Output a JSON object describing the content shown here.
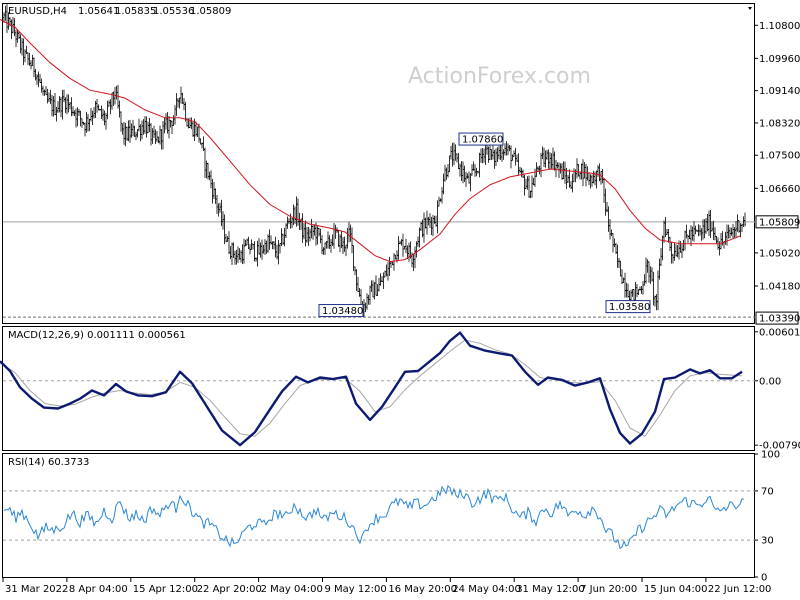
{
  "chart_data": {
    "type": "candlestick",
    "header": {
      "symbol": "EURUSD,H4",
      "open": "1.05641",
      "high": "1.05835",
      "low": "1.05536",
      "close": "1.05809"
    },
    "watermark": "ActionForex.com",
    "colors": {
      "background": "#ffffff",
      "bars": "#000000",
      "ma": "#d2141e",
      "macd": "#0d1a72",
      "signal": "#a7a7a7",
      "rsi": "#2a86d8",
      "watermark": "#cfcfcf",
      "grid": "#a0a0a0"
    },
    "x_labels": [
      "31 Mar 2022",
      "8 Apr 04:00",
      "15 Apr 12:00",
      "22 Apr 20:00",
      "2 May 04:00",
      "9 May 12:00",
      "16 May 20:00",
      "24 May 04:00",
      "31 May 12:00",
      "7 Jun 20:00",
      "15 Jun 04:00",
      "22 Jun 12:00"
    ],
    "price": {
      "ylim": [
        1.0324,
        1.1134
      ],
      "ticks": [
        "1.10800",
        "1.09960",
        "1.09140",
        "1.08320",
        "1.07500",
        "1.06660",
        "1.05020",
        "1.04180"
      ],
      "current": {
        "value": 1.05809,
        "label": "1.05809"
      },
      "low_line": {
        "value": 1.0339,
        "label": "1.03390"
      },
      "annotations": [
        {
          "label": "1.03480",
          "value": 1.0348,
          "index": 363
        },
        {
          "label": "1.07860",
          "value": 1.0786,
          "index": 503
        },
        {
          "label": "1.03580",
          "value": 1.0358,
          "index": 650
        }
      ],
      "close_path": [
        [
          4,
          1.11
        ],
        [
          15,
          1.106
        ],
        [
          25,
          1.1
        ],
        [
          35,
          1.097
        ],
        [
          45,
          1.089
        ],
        [
          55,
          1.087
        ],
        [
          65,
          1.089
        ],
        [
          75,
          1.086
        ],
        [
          85,
          1.083
        ],
        [
          95,
          1.087
        ],
        [
          105,
          1.084
        ],
        [
          115,
          1.091
        ],
        [
          123,
          1.08
        ],
        [
          135,
          1.081
        ],
        [
          145,
          1.083
        ],
        [
          155,
          1.078
        ],
        [
          165,
          1.082
        ],
        [
          175,
          1.085
        ],
        [
          180,
          1.092
        ],
        [
          188,
          1.083
        ],
        [
          198,
          1.081
        ],
        [
          205,
          1.073
        ],
        [
          212,
          1.067
        ],
        [
          220,
          1.06
        ],
        [
          228,
          1.052
        ],
        [
          238,
          1.049
        ],
        [
          248,
          1.052
        ],
        [
          258,
          1.05
        ],
        [
          268,
          1.053
        ],
        [
          278,
          1.05
        ],
        [
          288,
          1.058
        ],
        [
          296,
          1.061
        ],
        [
          305,
          1.054
        ],
        [
          315,
          1.056
        ],
        [
          325,
          1.051
        ],
        [
          335,
          1.055
        ],
        [
          343,
          1.052
        ],
        [
          350,
          1.055
        ],
        [
          356,
          1.044
        ],
        [
          362,
          1.036
        ],
        [
          370,
          1.04
        ],
        [
          380,
          1.042
        ],
        [
          388,
          1.046
        ],
        [
          396,
          1.051
        ],
        [
          404,
          1.053
        ],
        [
          412,
          1.049
        ],
        [
          420,
          1.056
        ],
        [
          428,
          1.058
        ],
        [
          436,
          1.059
        ],
        [
          444,
          1.07
        ],
        [
          452,
          1.075
        ],
        [
          460,
          1.072
        ],
        [
          468,
          1.068
        ],
        [
          476,
          1.071
        ],
        [
          485,
          1.077
        ],
        [
          493,
          1.074
        ],
        [
          503,
          1.077
        ],
        [
          512,
          1.075
        ],
        [
          520,
          1.07
        ],
        [
          530,
          1.066
        ],
        [
          540,
          1.073
        ],
        [
          550,
          1.075
        ],
        [
          560,
          1.071
        ],
        [
          570,
          1.068
        ],
        [
          580,
          1.072
        ],
        [
          590,
          1.069
        ],
        [
          600,
          1.071
        ],
        [
          608,
          1.058
        ],
        [
          616,
          1.049
        ],
        [
          624,
          1.043
        ],
        [
          632,
          1.039
        ],
        [
          640,
          1.041
        ],
        [
          648,
          1.047
        ],
        [
          656,
          1.037
        ],
        [
          664,
          1.058
        ],
        [
          672,
          1.05
        ],
        [
          680,
          1.052
        ],
        [
          690,
          1.055
        ],
        [
          700,
          1.055
        ],
        [
          710,
          1.058
        ],
        [
          720,
          1.052
        ],
        [
          730,
          1.055
        ],
        [
          740,
          1.058
        ]
      ],
      "ma_path": [
        [
          0,
          1.1095
        ],
        [
          15,
          1.1075
        ],
        [
          30,
          1.1035
        ],
        [
          50,
          1.0985
        ],
        [
          70,
          1.0945
        ],
        [
          90,
          1.0915
        ],
        [
          110,
          1.0905
        ],
        [
          125,
          1.0895
        ],
        [
          145,
          1.0865
        ],
        [
          165,
          1.0845
        ],
        [
          180,
          1.0845
        ],
        [
          195,
          1.0835
        ],
        [
          210,
          1.0795
        ],
        [
          230,
          1.0735
        ],
        [
          250,
          1.0675
        ],
        [
          270,
          1.0625
        ],
        [
          290,
          1.0595
        ],
        [
          310,
          1.0575
        ],
        [
          330,
          1.0565
        ],
        [
          345,
          1.0555
        ],
        [
          360,
          1.0525
        ],
        [
          375,
          1.0495
        ],
        [
          390,
          1.048
        ],
        [
          405,
          1.0485
        ],
        [
          420,
          1.051
        ],
        [
          440,
          1.055
        ],
        [
          455,
          1.06
        ],
        [
          470,
          1.064
        ],
        [
          490,
          1.0675
        ],
        [
          510,
          1.0695
        ],
        [
          530,
          1.0705
        ],
        [
          550,
          1.0715
        ],
        [
          570,
          1.071
        ],
        [
          590,
          1.0705
        ],
        [
          600,
          1.07
        ],
        [
          615,
          1.0665
        ],
        [
          630,
          1.061
        ],
        [
          645,
          1.0565
        ],
        [
          660,
          1.0535
        ],
        [
          680,
          1.0525
        ],
        [
          700,
          1.0525
        ],
        [
          720,
          1.0525
        ],
        [
          740,
          1.0545
        ]
      ]
    },
    "macd": {
      "label": "MACD(12,26,9) 0.001111 0.000561",
      "ylim": [
        -0.0085,
        0.0066
      ],
      "ticks": [
        {
          "value": 0.006012,
          "label": "0.006012"
        },
        {
          "value": 0.0,
          "label": "0.00"
        },
        {
          "value": -0.007907,
          "label": "-0.007907"
        }
      ],
      "main_path": [
        [
          0,
          0.0024
        ],
        [
          10,
          0.0012
        ],
        [
          20,
          -0.0008
        ],
        [
          32,
          -0.0022
        ],
        [
          44,
          -0.0033
        ],
        [
          58,
          -0.0034
        ],
        [
          70,
          -0.0028
        ],
        [
          80,
          -0.0022
        ],
        [
          92,
          -0.0012
        ],
        [
          104,
          -0.0018
        ],
        [
          116,
          -0.0004
        ],
        [
          126,
          -0.0013
        ],
        [
          138,
          -0.0018
        ],
        [
          152,
          -0.0019
        ],
        [
          166,
          -0.0014
        ],
        [
          180,
          0.0011
        ],
        [
          192,
          -0.0003
        ],
        [
          205,
          -0.0028
        ],
        [
          222,
          -0.0061
        ],
        [
          240,
          -0.0079
        ],
        [
          255,
          -0.0063
        ],
        [
          270,
          -0.0035
        ],
        [
          282,
          -0.0013
        ],
        [
          296,
          0.0005
        ],
        [
          308,
          -0.0002
        ],
        [
          320,
          0.0004
        ],
        [
          333,
          0.0002
        ],
        [
          346,
          0.0005
        ],
        [
          356,
          -0.0028
        ],
        [
          370,
          -0.0048
        ],
        [
          382,
          -0.0032
        ],
        [
          395,
          -0.0008
        ],
        [
          405,
          0.0011
        ],
        [
          418,
          0.0012
        ],
        [
          430,
          0.0024
        ],
        [
          440,
          0.0034
        ],
        [
          450,
          0.0049
        ],
        [
          460,
          0.0059
        ],
        [
          470,
          0.0043
        ],
        [
          485,
          0.0037
        ],
        [
          498,
          0.0034
        ],
        [
          512,
          0.0031
        ],
        [
          525,
          0.0011
        ],
        [
          538,
          -0.0005
        ],
        [
          548,
          0.0004
        ],
        [
          562,
          0.0001
        ],
        [
          575,
          -0.0006
        ],
        [
          588,
          -0.0002
        ],
        [
          600,
          0.0003
        ],
        [
          610,
          -0.0035
        ],
        [
          620,
          -0.0064
        ],
        [
          630,
          -0.0077
        ],
        [
          642,
          -0.0065
        ],
        [
          655,
          -0.0038
        ],
        [
          664,
          0.0002
        ],
        [
          675,
          0.0004
        ],
        [
          690,
          0.0014
        ],
        [
          700,
          0.0009
        ],
        [
          710,
          0.0013
        ],
        [
          720,
          0.0003
        ],
        [
          732,
          0.0003
        ],
        [
          742,
          0.0011
        ]
      ],
      "signal_path": [
        [
          0,
          0.0022
        ],
        [
          15,
          0.001
        ],
        [
          30,
          -0.0012
        ],
        [
          45,
          -0.0028
        ],
        [
          60,
          -0.0031
        ],
        [
          75,
          -0.0029
        ],
        [
          90,
          -0.0021
        ],
        [
          105,
          -0.0015
        ],
        [
          120,
          -0.0012
        ],
        [
          135,
          -0.0015
        ],
        [
          150,
          -0.0017
        ],
        [
          165,
          -0.0014
        ],
        [
          180,
          -0.0002
        ],
        [
          195,
          -0.0008
        ],
        [
          210,
          -0.0024
        ],
        [
          225,
          -0.0045
        ],
        [
          240,
          -0.0065
        ],
        [
          255,
          -0.0068
        ],
        [
          270,
          -0.0052
        ],
        [
          285,
          -0.0028
        ],
        [
          300,
          -0.0006
        ],
        [
          315,
          0.0001
        ],
        [
          330,
          0.0002
        ],
        [
          345,
          0.0003
        ],
        [
          360,
          -0.0013
        ],
        [
          375,
          -0.0038
        ],
        [
          390,
          -0.0032
        ],
        [
          405,
          -0.0011
        ],
        [
          420,
          0.0006
        ],
        [
          435,
          0.0021
        ],
        [
          450,
          0.0036
        ],
        [
          465,
          0.005
        ],
        [
          480,
          0.0046
        ],
        [
          495,
          0.0038
        ],
        [
          510,
          0.0033
        ],
        [
          525,
          0.002
        ],
        [
          540,
          0.0004
        ],
        [
          555,
          0.0001
        ],
        [
          570,
          -0.0002
        ],
        [
          585,
          -0.0003
        ],
        [
          600,
          -0.0001
        ],
        [
          615,
          -0.0024
        ],
        [
          630,
          -0.0058
        ],
        [
          645,
          -0.0068
        ],
        [
          660,
          -0.0042
        ],
        [
          675,
          -0.0012
        ],
        [
          690,
          0.0006
        ],
        [
          705,
          0.001
        ],
        [
          720,
          0.0008
        ],
        [
          742,
          0.0006
        ]
      ]
    },
    "rsi": {
      "label": "RSI(14) 60.3733",
      "ylim": [
        0,
        100
      ],
      "ticks": [
        {
          "value": 100,
          "label": "100"
        },
        {
          "value": 70,
          "label": "70"
        },
        {
          "value": 30,
          "label": "30"
        },
        {
          "value": 0,
          "label": "0"
        }
      ],
      "levels": [
        70,
        30
      ],
      "path": [
        [
          0,
          50
        ],
        [
          8,
          56
        ],
        [
          15,
          48
        ],
        [
          22,
          53
        ],
        [
          30,
          44
        ],
        [
          38,
          33
        ],
        [
          46,
          40
        ],
        [
          55,
          38
        ],
        [
          64,
          43
        ],
        [
          72,
          52
        ],
        [
          80,
          45
        ],
        [
          88,
          50
        ],
        [
          96,
          43
        ],
        [
          104,
          54
        ],
        [
          112,
          48
        ],
        [
          120,
          62
        ],
        [
          128,
          48
        ],
        [
          136,
          51
        ],
        [
          144,
          46
        ],
        [
          152,
          56
        ],
        [
          160,
          50
        ],
        [
          168,
          60
        ],
        [
          176,
          56
        ],
        [
          180,
          69
        ],
        [
          186,
          60
        ],
        [
          194,
          52
        ],
        [
          202,
          44
        ],
        [
          210,
          43
        ],
        [
          218,
          36
        ],
        [
          226,
          30
        ],
        [
          234,
          26
        ],
        [
          240,
          32
        ],
        [
          248,
          40
        ],
        [
          256,
          44
        ],
        [
          264,
          42
        ],
        [
          272,
          50
        ],
        [
          280,
          52
        ],
        [
          288,
          48
        ],
        [
          294,
          60
        ],
        [
          300,
          53
        ],
        [
          308,
          48
        ],
        [
          316,
          55
        ],
        [
          324,
          46
        ],
        [
          332,
          52
        ],
        [
          340,
          50
        ],
        [
          348,
          46
        ],
        [
          356,
          36
        ],
        [
          362,
          30
        ],
        [
          368,
          42
        ],
        [
          376,
          48
        ],
        [
          384,
          50
        ],
        [
          392,
          58
        ],
        [
          400,
          62
        ],
        [
          408,
          56
        ],
        [
          416,
          60
        ],
        [
          424,
          58
        ],
        [
          432,
          63
        ],
        [
          440,
          68
        ],
        [
          448,
          72
        ],
        [
          456,
          66
        ],
        [
          464,
          68
        ],
        [
          472,
          60
        ],
        [
          480,
          64
        ],
        [
          488,
          68
        ],
        [
          496,
          62
        ],
        [
          504,
          66
        ],
        [
          512,
          56
        ],
        [
          520,
          48
        ],
        [
          528,
          52
        ],
        [
          536,
          46
        ],
        [
          544,
          56
        ],
        [
          552,
          52
        ],
        [
          560,
          60
        ],
        [
          568,
          50
        ],
        [
          576,
          56
        ],
        [
          584,
          50
        ],
        [
          592,
          56
        ],
        [
          600,
          50
        ],
        [
          606,
          38
        ],
        [
          612,
          34
        ],
        [
          620,
          26
        ],
        [
          628,
          24
        ],
        [
          636,
          36
        ],
        [
          644,
          42
        ],
        [
          652,
          48
        ],
        [
          660,
          54
        ],
        [
          668,
          50
        ],
        [
          676,
          58
        ],
        [
          684,
          62
        ],
        [
          692,
          60
        ],
        [
          700,
          58
        ],
        [
          708,
          66
        ],
        [
          716,
          52
        ],
        [
          724,
          56
        ],
        [
          732,
          58
        ],
        [
          740,
          60
        ]
      ]
    }
  }
}
